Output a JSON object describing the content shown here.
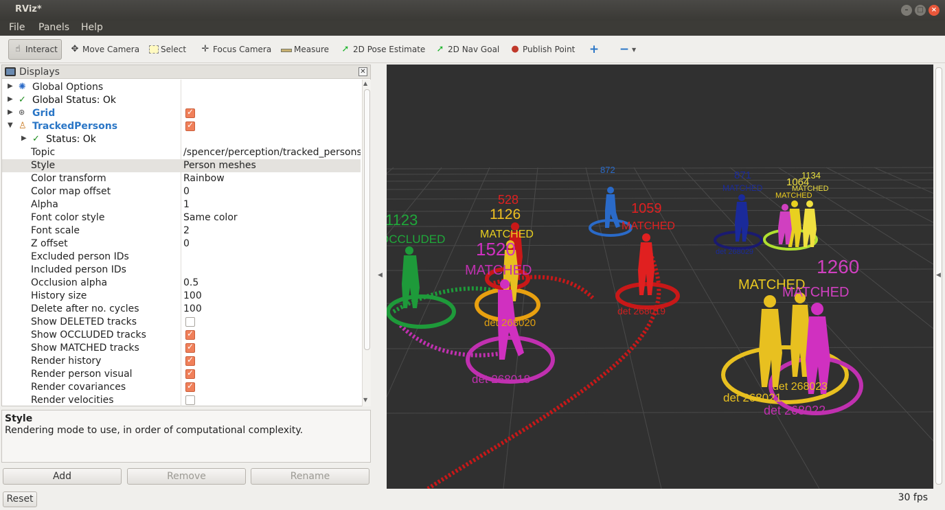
{
  "window": {
    "title": "RViz*"
  },
  "menu": [
    "File",
    "Panels",
    "Help"
  ],
  "toolbar": {
    "interact": "Interact",
    "move_camera": "Move Camera",
    "select": "Select",
    "focus_camera": "Focus Camera",
    "measure": "Measure",
    "pose_estimate": "2D Pose Estimate",
    "nav_goal": "2D Nav Goal",
    "publish_point": "Publish Point"
  },
  "displays": {
    "title": "Displays",
    "rows": [
      {
        "label": "Global Options",
        "value": ""
      },
      {
        "label": "Global Status: Ok",
        "value": ""
      },
      {
        "label": "Grid",
        "value": "",
        "checked": true
      },
      {
        "label": "TrackedPersons",
        "value": "",
        "checked": true
      },
      {
        "label": "Status: Ok",
        "value": ""
      },
      {
        "label": "Topic",
        "value": "/spencer/perception/tracked_persons"
      },
      {
        "label": "Style",
        "value": "Person meshes"
      },
      {
        "label": "Color transform",
        "value": "Rainbow"
      },
      {
        "label": "Color map offset",
        "value": "0"
      },
      {
        "label": "Alpha",
        "value": "1"
      },
      {
        "label": "Font color style",
        "value": "Same color"
      },
      {
        "label": "Font scale",
        "value": "2"
      },
      {
        "label": "Z offset",
        "value": "0"
      },
      {
        "label": "Excluded person IDs",
        "value": ""
      },
      {
        "label": "Included person IDs",
        "value": ""
      },
      {
        "label": "Occlusion alpha",
        "value": "0.5"
      },
      {
        "label": "History size",
        "value": "100"
      },
      {
        "label": "Delete after no. cycles",
        "value": "100"
      },
      {
        "label": "Show DELETED tracks",
        "value": "",
        "checked": false
      },
      {
        "label": "Show OCCLUDED tracks",
        "value": "",
        "checked": true
      },
      {
        "label": "Show MATCHED tracks",
        "value": "",
        "checked": true
      },
      {
        "label": "Render history",
        "value": "",
        "checked": true
      },
      {
        "label": "Render person visual",
        "value": "",
        "checked": true
      },
      {
        "label": "Render covariances",
        "value": "",
        "checked": true
      },
      {
        "label": "Render velocities",
        "value": "",
        "checked": false
      }
    ]
  },
  "description": {
    "title": "Style",
    "text": "Rendering mode to use, in order of computational complexity."
  },
  "buttons": {
    "add": "Add",
    "remove": "Remove",
    "rename": "Rename",
    "reset": "Reset"
  },
  "status": {
    "fps": "30 fps"
  },
  "scene": {
    "labels": [
      {
        "text": "1123",
        "color": "#1fa83a"
      },
      {
        "text": "OCCLUDED",
        "color": "#1fa83a"
      },
      {
        "text": "528",
        "color": "#e02020"
      },
      {
        "text": "1126",
        "color": "#f0c020"
      },
      {
        "text": "MATCHED",
        "color": "#e8d020"
      },
      {
        "text": "1520",
        "color": "#d030c0"
      },
      {
        "text": "MATCHED",
        "color": "#c030b0"
      },
      {
        "text": "det 268020",
        "color": "#e0a010"
      },
      {
        "text": "det 268018",
        "color": "#c030b0"
      },
      {
        "text": "872",
        "color": "#2a6ac8"
      },
      {
        "text": "1059",
        "color": "#e02020"
      },
      {
        "text": "MATCHED",
        "color": "#e02020"
      },
      {
        "text": "det 268019",
        "color": "#d02020"
      },
      {
        "text": "871",
        "color": "#1a2a9a"
      },
      {
        "text": "MATCHED",
        "color": "#1a2a9a"
      },
      {
        "text": "det 268029",
        "color": "#1a2a9a"
      },
      {
        "text": "1064",
        "color": "#f0e040"
      },
      {
        "text": "1134",
        "color": "#e8e040"
      },
      {
        "text": "MATCHED",
        "color": "#f0e040"
      },
      {
        "text": "MATCHED",
        "color": "#f0d020"
      },
      {
        "text": "MATCHED",
        "color": "#e8c820"
      },
      {
        "text": "MATCHED",
        "color": "#d040c0"
      },
      {
        "text": "1260",
        "color": "#d040c0"
      },
      {
        "text": "det 268021",
        "color": "#e8c020"
      },
      {
        "text": "det 268023",
        "color": "#e8c020"
      },
      {
        "text": "det 268022",
        "color": "#c030b0"
      }
    ]
  }
}
